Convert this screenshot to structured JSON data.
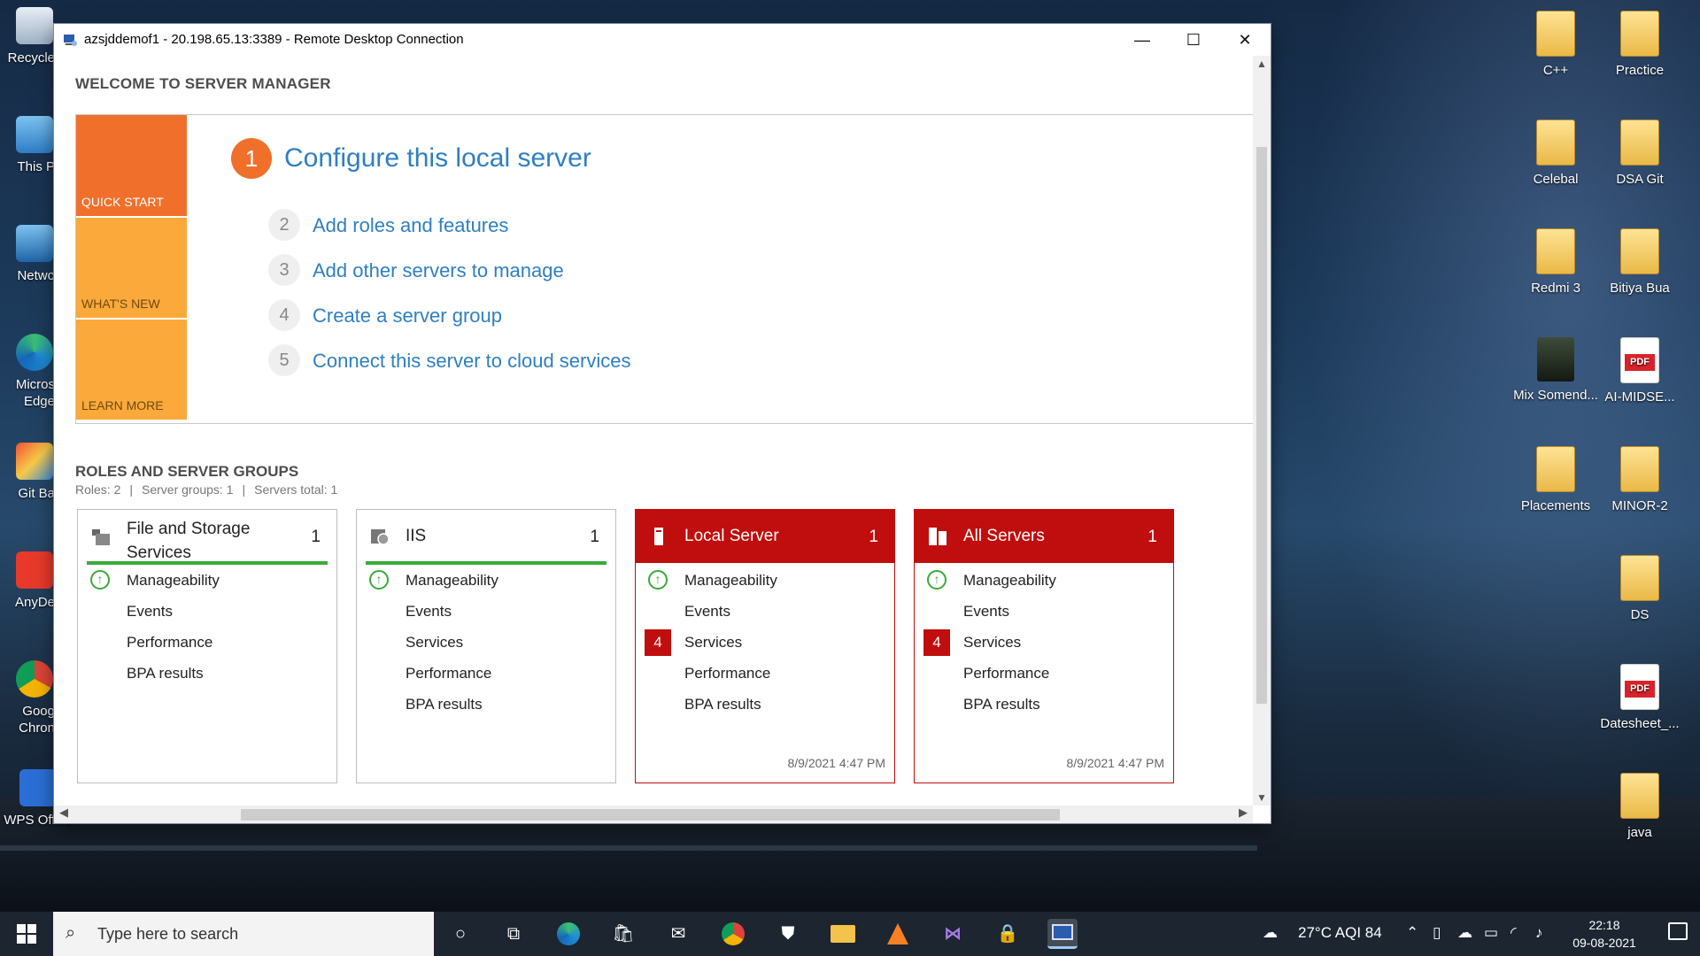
{
  "desktop": {
    "left_icons": [
      {
        "label": "Recycle"
      },
      {
        "label": "This P"
      },
      {
        "label": "Netwo"
      },
      {
        "label": "Micros Edge"
      },
      {
        "label": "Git Ba"
      },
      {
        "label": "AnyDe"
      },
      {
        "label": "Goog Chron"
      },
      {
        "label": "WPS Office"
      }
    ],
    "right_icons": [
      {
        "label": "C++"
      },
      {
        "label": "Practice"
      },
      {
        "label": "Celebal"
      },
      {
        "label": "DSA Git"
      },
      {
        "label": "Redmi 3"
      },
      {
        "label": "Bitiya Bua"
      },
      {
        "label": "Mix Somend..."
      },
      {
        "label": "AI-MIDSE..."
      },
      {
        "label": "Placements"
      },
      {
        "label": "MINOR-2"
      },
      {
        "label": "DS"
      },
      {
        "label": "Datesheet_..."
      },
      {
        "label": "java"
      }
    ]
  },
  "window": {
    "title": "azsjddemof1 - 20.198.65.13:3389 - Remote Desktop Connection",
    "controls": {
      "minimize": "—",
      "maximize": "☐",
      "close": "✕"
    }
  },
  "server_manager": {
    "welcome_title": "WELCOME TO SERVER MANAGER",
    "tiles": {
      "quick_start": "QUICK START",
      "whats_new": "WHAT'S NEW",
      "learn_more": "LEARN MORE"
    },
    "steps": [
      {
        "num": "1",
        "label": "Configure this local server"
      },
      {
        "num": "2",
        "label": "Add roles and features"
      },
      {
        "num": "3",
        "label": "Add other servers to manage"
      },
      {
        "num": "4",
        "label": "Create a server group"
      },
      {
        "num": "5",
        "label": "Connect this server to cloud services"
      }
    ],
    "roles_title": "ROLES AND SERVER GROUPS",
    "roles_summary": {
      "roles": "Roles: 2",
      "groups": "Server groups: 1",
      "servers": "Servers total: 1",
      "sep": "|"
    },
    "cards": [
      {
        "name": "File and Storage Services",
        "count": "1",
        "rows": [
          "Manageability",
          "Events",
          "Performance",
          "BPA results"
        ]
      },
      {
        "name": "IIS",
        "count": "1",
        "rows": [
          "Manageability",
          "Events",
          "Services",
          "Performance",
          "BPA results"
        ]
      },
      {
        "name": "Local Server",
        "count": "1",
        "rows": [
          "Manageability",
          "Events",
          "Services",
          "Performance",
          "BPA results"
        ],
        "services_badge": "4",
        "timestamp": "8/9/2021 4:47 PM"
      },
      {
        "name": "All Servers",
        "count": "1",
        "rows": [
          "Manageability",
          "Events",
          "Services",
          "Performance",
          "BPA results"
        ],
        "services_badge": "4",
        "timestamp": "8/9/2021 4:47 PM"
      }
    ]
  },
  "taskbar": {
    "search_placeholder": "Type here to search",
    "weather": "27°C  AQI 84",
    "time": "22:18",
    "date": "09-08-2021"
  },
  "colors": {
    "accent_orange": "#f0702b",
    "tile_yellow": "#fba93a",
    "link_blue": "#2f7fc1",
    "alert_red": "#c00d0d",
    "ok_green": "#3aab3a"
  }
}
